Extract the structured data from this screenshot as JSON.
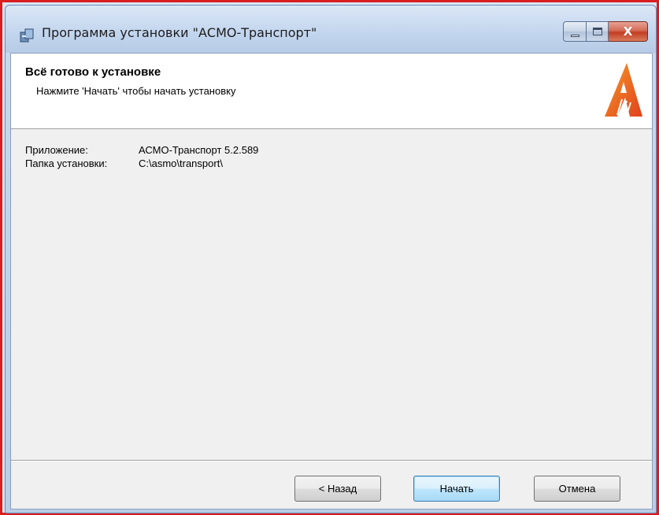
{
  "window": {
    "title": "Программа установки \"АСМО-Транспорт\"",
    "close_glyph": "X"
  },
  "header": {
    "title": "Всё готово к установке",
    "subtitle": "Нажмите 'Начать' чтобы начать установку",
    "logo_icon": "asmo-logo-icon"
  },
  "info": {
    "app_label": "Приложение:",
    "app_value": "АСМО-Транспорт 5.2.589",
    "folder_label": "Папка установки:",
    "folder_value": "C:\\asmo\\transport\\"
  },
  "buttons": {
    "back": "< Назад",
    "start": "Начать",
    "cancel": "Отмена"
  },
  "colors": {
    "frame_highlight": "#d81e1e",
    "close_button": "#c23d22",
    "logo_orange": "#f26a1b"
  }
}
